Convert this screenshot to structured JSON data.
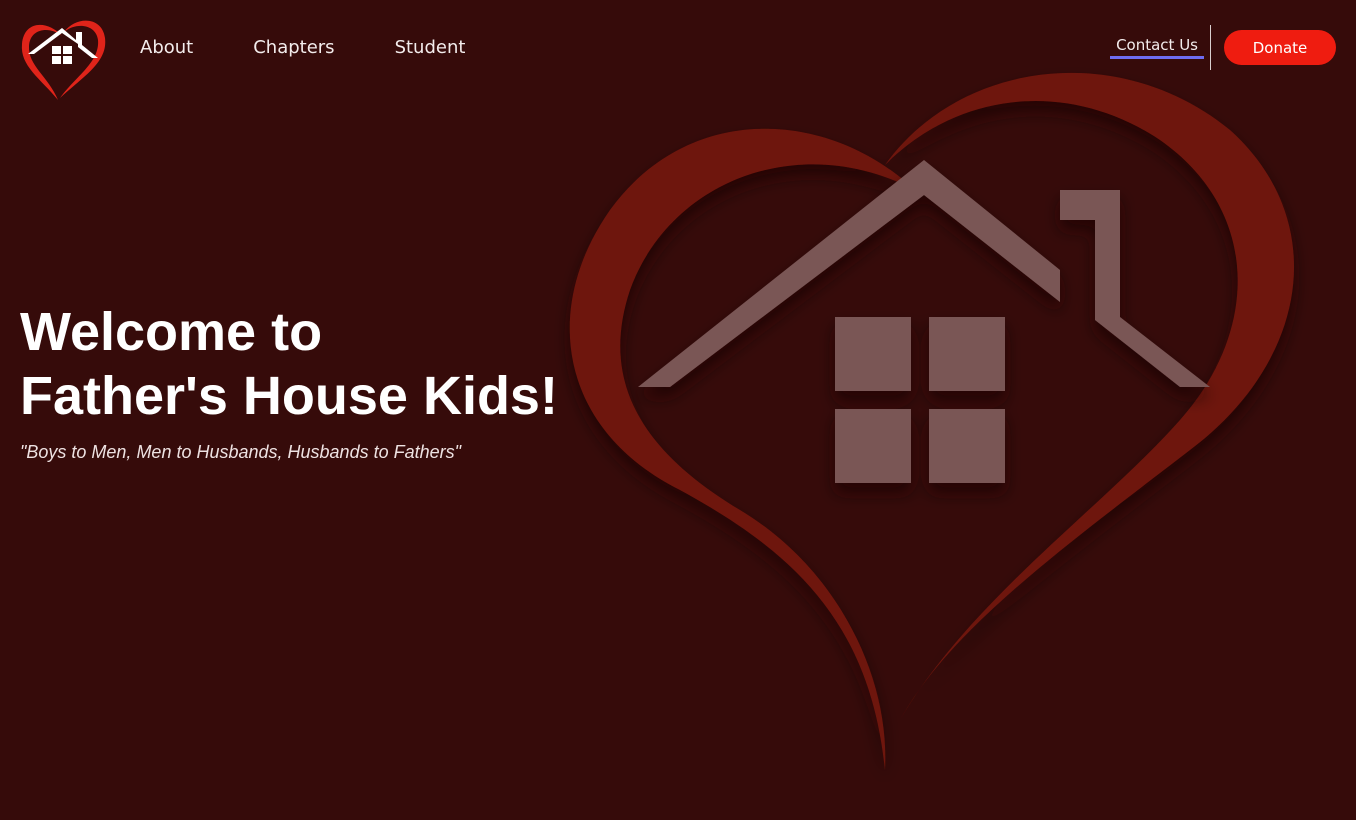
{
  "header": {
    "nav": [
      {
        "label": "About"
      },
      {
        "label": "Chapters"
      },
      {
        "label": "Student"
      }
    ],
    "contact_label": "Contact Us",
    "donate_label": "Donate"
  },
  "hero": {
    "title_line1": "Welcome to",
    "title_line2": "Father's House Kids!",
    "tagline": "\"Boys to Men, Men to Husbands, Husbands to Fathers\""
  },
  "icons": {
    "logo": "heart-house-logo-icon",
    "hero_art": "heart-house-illustration"
  },
  "colors": {
    "background": "#360b0a",
    "heart": "#6e150c",
    "house": "#7a5655",
    "accent_red": "#ef1c10",
    "underline": "#6e6cf0"
  }
}
